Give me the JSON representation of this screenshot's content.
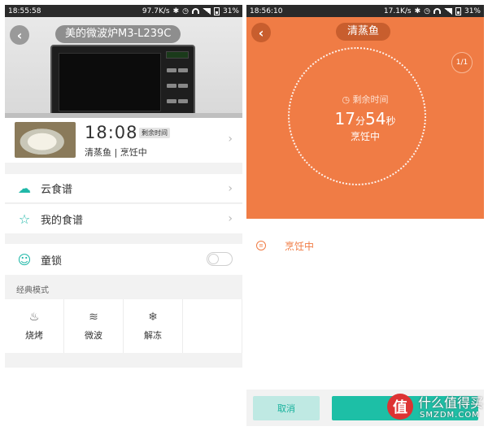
{
  "left": {
    "statusbar": {
      "time": "18:55:58",
      "speed": "97.7K/s",
      "battery": "31%"
    },
    "model_title": "美的微波炉M3-L239C",
    "status_card": {
      "time": "18:08",
      "remain_tag": "剩余时间",
      "dish": "清蒸鱼",
      "state": "烹饪中"
    },
    "menu": [
      {
        "label": "云食谱",
        "icon": "cloud-icon"
      },
      {
        "label": "我的食谱",
        "icon": "star-icon"
      }
    ],
    "child_lock": {
      "label": "童锁",
      "icon": "baby-face-icon",
      "enabled": false
    },
    "section_label": "经典模式",
    "modes": [
      {
        "label": "烧烤",
        "icon": "grill-icon"
      },
      {
        "label": "微波",
        "icon": "microwave-wave-icon"
      },
      {
        "label": "解冻",
        "icon": "snowflake-icon"
      }
    ]
  },
  "right": {
    "statusbar": {
      "time": "18:56:10",
      "speed": "17.1K/s",
      "battery": "31%"
    },
    "title": "清蒸鱼",
    "page_indicator": "1/1",
    "remain_label": "剩余时间",
    "remaining": {
      "minutes": "17",
      "minutes_unit": "分",
      "seconds": "54",
      "seconds_unit": "秒"
    },
    "cooking_state": "烹饪中",
    "step_status": "烹饪中",
    "cancel_label": "取消"
  },
  "watermark": {
    "text": "什么值得买",
    "sub": "SMZDM.COM",
    "logo": "值"
  },
  "colors": {
    "accent_orange": "#f07c45",
    "accent_teal": "#1dbfa6"
  }
}
